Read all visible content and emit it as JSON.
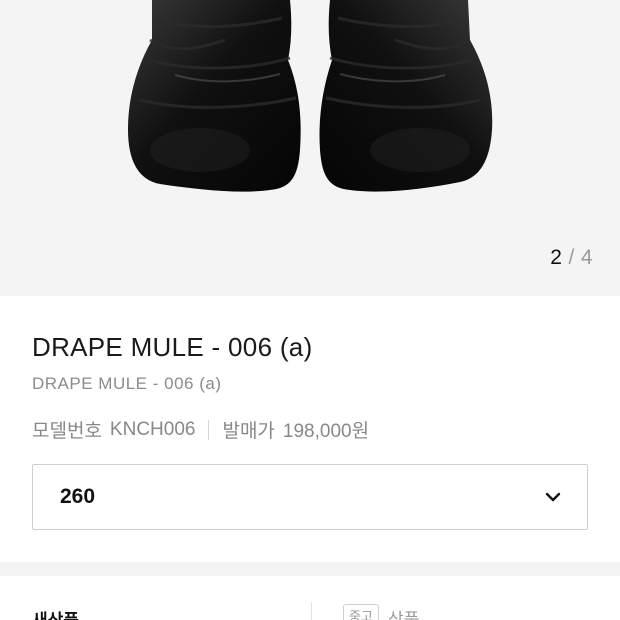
{
  "gallery": {
    "current": "2",
    "separator": "/",
    "total": "4"
  },
  "product": {
    "title": "DRAPE MULE - 006 (a)",
    "subtitle": "DRAPE MULE - 006 (a)",
    "model_label": "모델번호",
    "model_value": "KNCH006",
    "price_label": "발매가",
    "price_value": "198,000원"
  },
  "size_selector": {
    "value": "260",
    "icon": "chevron-down-icon"
  },
  "condition": {
    "new_label": "새상품",
    "used_badge": "중고",
    "used_label": "상품"
  },
  "colors": {
    "hero_bg": "#f4f4f4",
    "shoe": "#0d0d0d",
    "muted_text": "#8c8c8c",
    "border": "#cfcfcf"
  }
}
